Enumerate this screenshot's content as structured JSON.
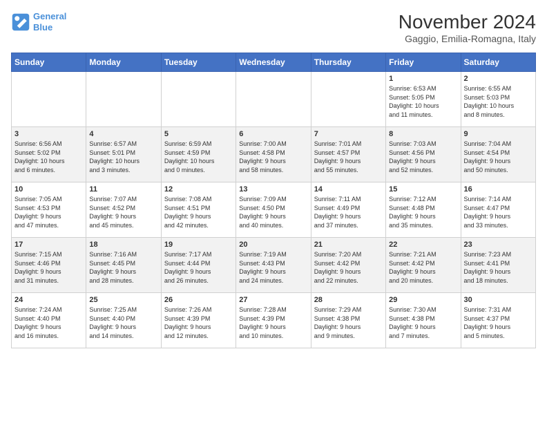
{
  "header": {
    "logo_line1": "General",
    "logo_line2": "Blue",
    "title": "November 2024",
    "subtitle": "Gaggio, Emilia-Romagna, Italy"
  },
  "days_of_week": [
    "Sunday",
    "Monday",
    "Tuesday",
    "Wednesday",
    "Thursday",
    "Friday",
    "Saturday"
  ],
  "weeks": [
    [
      {
        "day": "",
        "info": ""
      },
      {
        "day": "",
        "info": ""
      },
      {
        "day": "",
        "info": ""
      },
      {
        "day": "",
        "info": ""
      },
      {
        "day": "",
        "info": ""
      },
      {
        "day": "1",
        "info": "Sunrise: 6:53 AM\nSunset: 5:05 PM\nDaylight: 10 hours\nand 11 minutes."
      },
      {
        "day": "2",
        "info": "Sunrise: 6:55 AM\nSunset: 5:03 PM\nDaylight: 10 hours\nand 8 minutes."
      }
    ],
    [
      {
        "day": "3",
        "info": "Sunrise: 6:56 AM\nSunset: 5:02 PM\nDaylight: 10 hours\nand 6 minutes."
      },
      {
        "day": "4",
        "info": "Sunrise: 6:57 AM\nSunset: 5:01 PM\nDaylight: 10 hours\nand 3 minutes."
      },
      {
        "day": "5",
        "info": "Sunrise: 6:59 AM\nSunset: 4:59 PM\nDaylight: 10 hours\nand 0 minutes."
      },
      {
        "day": "6",
        "info": "Sunrise: 7:00 AM\nSunset: 4:58 PM\nDaylight: 9 hours\nand 58 minutes."
      },
      {
        "day": "7",
        "info": "Sunrise: 7:01 AM\nSunset: 4:57 PM\nDaylight: 9 hours\nand 55 minutes."
      },
      {
        "day": "8",
        "info": "Sunrise: 7:03 AM\nSunset: 4:56 PM\nDaylight: 9 hours\nand 52 minutes."
      },
      {
        "day": "9",
        "info": "Sunrise: 7:04 AM\nSunset: 4:54 PM\nDaylight: 9 hours\nand 50 minutes."
      }
    ],
    [
      {
        "day": "10",
        "info": "Sunrise: 7:05 AM\nSunset: 4:53 PM\nDaylight: 9 hours\nand 47 minutes."
      },
      {
        "day": "11",
        "info": "Sunrise: 7:07 AM\nSunset: 4:52 PM\nDaylight: 9 hours\nand 45 minutes."
      },
      {
        "day": "12",
        "info": "Sunrise: 7:08 AM\nSunset: 4:51 PM\nDaylight: 9 hours\nand 42 minutes."
      },
      {
        "day": "13",
        "info": "Sunrise: 7:09 AM\nSunset: 4:50 PM\nDaylight: 9 hours\nand 40 minutes."
      },
      {
        "day": "14",
        "info": "Sunrise: 7:11 AM\nSunset: 4:49 PM\nDaylight: 9 hours\nand 37 minutes."
      },
      {
        "day": "15",
        "info": "Sunrise: 7:12 AM\nSunset: 4:48 PM\nDaylight: 9 hours\nand 35 minutes."
      },
      {
        "day": "16",
        "info": "Sunrise: 7:14 AM\nSunset: 4:47 PM\nDaylight: 9 hours\nand 33 minutes."
      }
    ],
    [
      {
        "day": "17",
        "info": "Sunrise: 7:15 AM\nSunset: 4:46 PM\nDaylight: 9 hours\nand 31 minutes."
      },
      {
        "day": "18",
        "info": "Sunrise: 7:16 AM\nSunset: 4:45 PM\nDaylight: 9 hours\nand 28 minutes."
      },
      {
        "day": "19",
        "info": "Sunrise: 7:17 AM\nSunset: 4:44 PM\nDaylight: 9 hours\nand 26 minutes."
      },
      {
        "day": "20",
        "info": "Sunrise: 7:19 AM\nSunset: 4:43 PM\nDaylight: 9 hours\nand 24 minutes."
      },
      {
        "day": "21",
        "info": "Sunrise: 7:20 AM\nSunset: 4:42 PM\nDaylight: 9 hours\nand 22 minutes."
      },
      {
        "day": "22",
        "info": "Sunrise: 7:21 AM\nSunset: 4:42 PM\nDaylight: 9 hours\nand 20 minutes."
      },
      {
        "day": "23",
        "info": "Sunrise: 7:23 AM\nSunset: 4:41 PM\nDaylight: 9 hours\nand 18 minutes."
      }
    ],
    [
      {
        "day": "24",
        "info": "Sunrise: 7:24 AM\nSunset: 4:40 PM\nDaylight: 9 hours\nand 16 minutes."
      },
      {
        "day": "25",
        "info": "Sunrise: 7:25 AM\nSunset: 4:40 PM\nDaylight: 9 hours\nand 14 minutes."
      },
      {
        "day": "26",
        "info": "Sunrise: 7:26 AM\nSunset: 4:39 PM\nDaylight: 9 hours\nand 12 minutes."
      },
      {
        "day": "27",
        "info": "Sunrise: 7:28 AM\nSunset: 4:39 PM\nDaylight: 9 hours\nand 10 minutes."
      },
      {
        "day": "28",
        "info": "Sunrise: 7:29 AM\nSunset: 4:38 PM\nDaylight: 9 hours\nand 9 minutes."
      },
      {
        "day": "29",
        "info": "Sunrise: 7:30 AM\nSunset: 4:38 PM\nDaylight: 9 hours\nand 7 minutes."
      },
      {
        "day": "30",
        "info": "Sunrise: 7:31 AM\nSunset: 4:37 PM\nDaylight: 9 hours\nand 5 minutes."
      }
    ]
  ]
}
